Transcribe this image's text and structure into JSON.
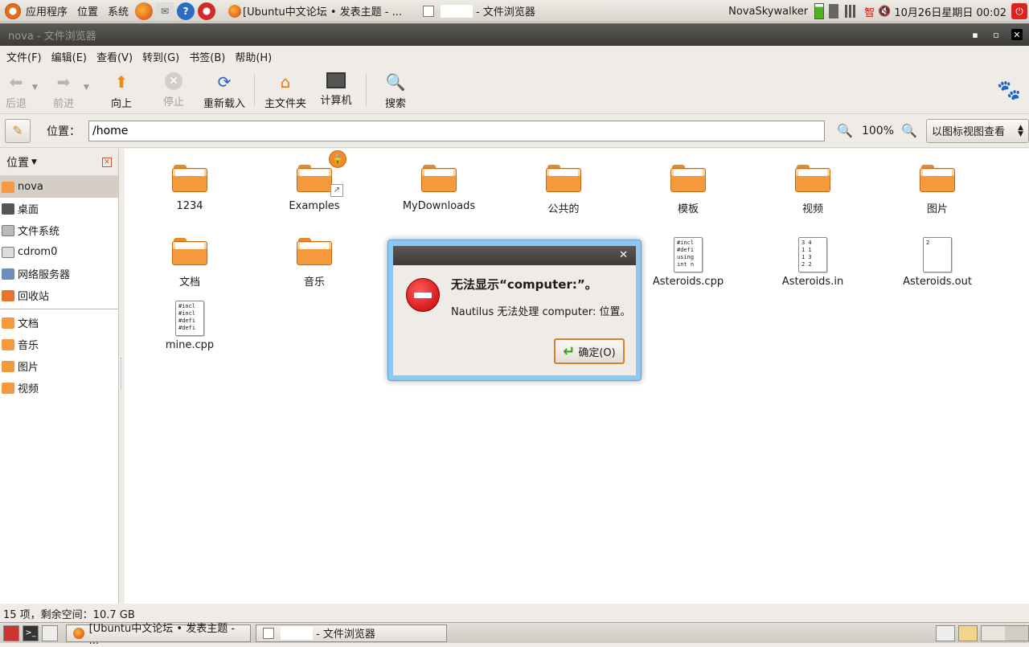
{
  "top_panel": {
    "menus": [
      "应用程序",
      "位置",
      "系统"
    ],
    "task_firefox": "[Ubuntu中文论坛 • 发表主题 - ...",
    "task_nautilus": "- 文件浏览器",
    "username": "NovaSkywalker",
    "ime_label": "智",
    "datetime": "10月26日星期日 00:02"
  },
  "window": {
    "title": "nova - 文件浏览器"
  },
  "menubar": [
    "文件(F)",
    "编辑(E)",
    "查看(V)",
    "转到(G)",
    "书签(B)",
    "帮助(H)"
  ],
  "toolbar": {
    "back": "后退",
    "forward": "前进",
    "up": "向上",
    "stop": "停止",
    "reload": "重新载入",
    "home": "主文件夹",
    "computer": "计算机",
    "search": "搜索"
  },
  "location": {
    "label": "位置：",
    "value": "/home",
    "zoom": "100%",
    "view_mode": "以图标视图查看"
  },
  "sidebar": {
    "title": "位置",
    "places": [
      "nova",
      "桌面",
      "文件系统",
      "cdrom0",
      "网络服务器",
      "回收站"
    ],
    "bookmarks": [
      "文档",
      "音乐",
      "图片",
      "视频"
    ]
  },
  "files": [
    {
      "name": "1234",
      "kind": "folder"
    },
    {
      "name": "Examples",
      "kind": "folder"
    },
    {
      "name": "MyDownloads",
      "kind": "folder"
    },
    {
      "name": "公共的",
      "kind": "folder"
    },
    {
      "name": "模板",
      "kind": "folder"
    },
    {
      "name": "视频",
      "kind": "folder"
    },
    {
      "name": "图片",
      "kind": "folder"
    },
    {
      "name": "文档",
      "kind": "folder"
    },
    {
      "name": "音乐",
      "kind": "folder"
    },
    {
      "name": "Asteroids.cpp",
      "kind": "text",
      "preview": "#incl\n#defi\nusing\nint n"
    },
    {
      "name": "Asteroids.in",
      "kind": "text",
      "preview": "3 4\n1 1\n1 3\n2 2"
    },
    {
      "name": "Asteroids.out",
      "kind": "text",
      "preview": "2"
    },
    {
      "name": "mine.cpp",
      "kind": "text",
      "preview": "#incl\n#incl\n#defi\n#defi"
    }
  ],
  "status": "15 项，剩余空间：10.7 GB",
  "bottom_panel": {
    "task_firefox": "[Ubuntu中文论坛 • 发表主题 - ...",
    "task_nautilus": "- 文件浏览器"
  },
  "dialog": {
    "primary": "无法显示“computer:”。",
    "secondary": "Nautilus 无法处理 computer: 位置。",
    "ok": "确定(O)"
  },
  "colors": {
    "folder_orange": "#f59a3c",
    "titlebar_dark": "#3c3b39",
    "dialog_frame": "#8cc8ef",
    "error_red": "#c40000",
    "selection": "#d5cec6"
  }
}
